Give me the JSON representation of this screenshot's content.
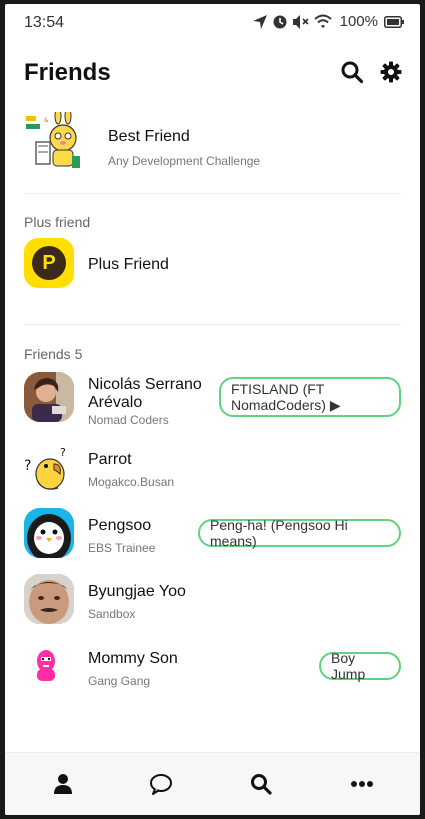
{
  "status": {
    "time": "13:54",
    "battery": "100%",
    "icons": [
      "location-icon",
      "alarm-icon",
      "mute-icon",
      "wifi-icon",
      "battery-icon"
    ]
  },
  "header": {
    "title": "Friends",
    "icons": [
      "search-icon",
      "gear-icon"
    ]
  },
  "best_friend": {
    "name": "Best Friend",
    "subtitle": "Any Development Challenge",
    "avatar_text": "&"
  },
  "plus_section": {
    "label": "Plus friend",
    "name": "Plus Friend",
    "logo_letter": "P"
  },
  "friends_section": {
    "label": "Friends 5",
    "items": [
      {
        "name": "Nicolás Serrano Arévalo",
        "subtitle": "Nomad Coders",
        "status": "FTISLAND (FT NomadCoders) ▶"
      },
      {
        "name": "Parrot",
        "subtitle": "Mogakco.Busan",
        "status": ""
      },
      {
        "name": "Pengsoo",
        "subtitle": "EBS Trainee",
        "status": "Peng-ha! (Pengsoo Hi means)"
      },
      {
        "name": "Byungjae Yoo",
        "subtitle": "Sandbox",
        "status": ""
      },
      {
        "name": "Mommy Son",
        "subtitle": "Gang Gang",
        "status": "Boy Jump"
      }
    ]
  },
  "bottom_nav": {
    "items": [
      "person-icon",
      "chat-bubble-icon",
      "search-icon",
      "more-icon"
    ]
  },
  "colors": {
    "status_border": "#5fd37d",
    "plus_logo_bg": "#ffde00",
    "plus_logo_fg": "#3b2a1a"
  }
}
